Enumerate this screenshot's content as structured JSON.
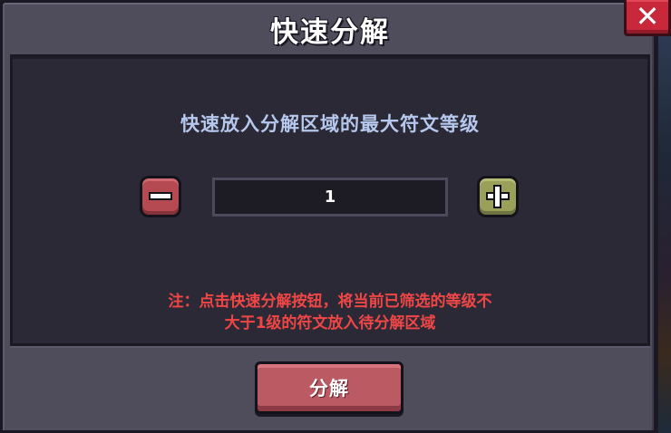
{
  "dialog": {
    "title": "快速分解",
    "close_icon": "✕"
  },
  "prompt": "快速放入分解区域的最大符文等级",
  "stepper": {
    "value": "1",
    "minus_icon": "minus-icon",
    "plus_icon": "plus-icon"
  },
  "note": {
    "line1": "注：点击快速分解按钮，将当前已筛选的等级不",
    "line2": "大于1级的符文放入待分解区域"
  },
  "action": {
    "label": "分解"
  },
  "colors": {
    "panel": "#4f4d5c",
    "inner": "#2b2935",
    "prompt_text": "#b6c8ee",
    "note_text": "#f04646",
    "close_button": "#c9283a",
    "minus_button": "#b64a52",
    "plus_button": "#9aa05a",
    "action_button": "#bc5a64"
  }
}
